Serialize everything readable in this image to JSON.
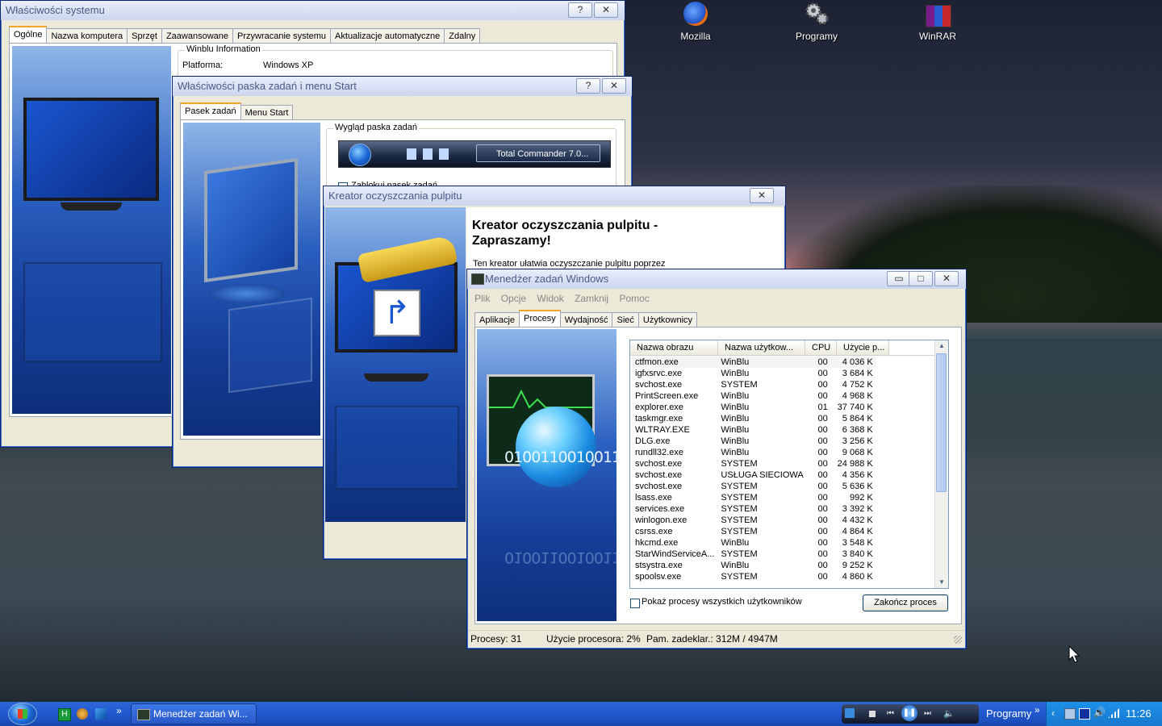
{
  "desktop": {
    "icons": [
      {
        "label": "Mozilla",
        "icon": "firefox-icon"
      },
      {
        "label": "Programy",
        "icon": "gears-icon"
      },
      {
        "label": "WinRAR",
        "icon": "winrar-icon"
      }
    ]
  },
  "sysprops": {
    "title": "Właściwości systemu",
    "help": "?",
    "close": "✕",
    "tabs": [
      "Ogólne",
      "Nazwa komputera",
      "Sprzęt",
      "Zaawansowane",
      "Przywracanie systemu",
      "Aktualizacje automatyczne",
      "Zdalny"
    ],
    "group_title": "Winblu Information",
    "platform_label": "Platforma:",
    "platform_value": "Windows XP"
  },
  "taskbarprops": {
    "title": "Właściwości paska zadań i menu Start",
    "help": "?",
    "close": "✕",
    "tabs": [
      "Pasek zadań",
      "Menu Start"
    ],
    "group_title": "Wygląd paska zadań",
    "preview_task": "Total Commander 7.0...",
    "lock_label": "Zablokuj pasek zadań"
  },
  "cleanup": {
    "title": "Kreator oczyszczania pulpitu",
    "close": "✕",
    "heading": "Kreator oczyszczania pulpitu - Zapraszamy!",
    "body": "Ten kreator ułatwia oczyszczanie pulpitu poprzez"
  },
  "taskmgr": {
    "title": "Menedżer zadań Windows",
    "min": "▭",
    "max": "□",
    "close": "✕",
    "menu": [
      "Plik",
      "Opcje",
      "Widok",
      "Zamknij",
      "Pomoc"
    ],
    "tabs": [
      "Aplikacje",
      "Procesy",
      "Wydajność",
      "Sieć",
      "Użytkownicy"
    ],
    "art_text": "0100110010011",
    "art_text_reflect": "0100110010011",
    "columns": [
      "Nazwa obrazu",
      "Nazwa użytkow...",
      "CPU",
      "Użycie p..."
    ],
    "rows": [
      [
        "ctfmon.exe",
        "WinBlu",
        "00",
        "4 036 K"
      ],
      [
        "igfxsrvc.exe",
        "WinBlu",
        "00",
        "3 684 K"
      ],
      [
        "svchost.exe",
        "SYSTEM",
        "00",
        "4 752 K"
      ],
      [
        "PrintScreen.exe",
        "WinBlu",
        "00",
        "4 968 K"
      ],
      [
        "explorer.exe",
        "WinBlu",
        "01",
        "37 740 K"
      ],
      [
        "taskmgr.exe",
        "WinBlu",
        "00",
        "5 864 K"
      ],
      [
        "WLTRAY.EXE",
        "WinBlu",
        "00",
        "6 368 K"
      ],
      [
        "DLG.exe",
        "WinBlu",
        "00",
        "3 256 K"
      ],
      [
        "rundll32.exe",
        "WinBlu",
        "00",
        "9 068 K"
      ],
      [
        "svchost.exe",
        "SYSTEM",
        "00",
        "24 988 K"
      ],
      [
        "svchost.exe",
        "USŁUGA SIECIOWA",
        "00",
        "4 356 K"
      ],
      [
        "svchost.exe",
        "SYSTEM",
        "00",
        "5 636 K"
      ],
      [
        "lsass.exe",
        "SYSTEM",
        "00",
        "992 K"
      ],
      [
        "services.exe",
        "SYSTEM",
        "00",
        "3 392 K"
      ],
      [
        "winlogon.exe",
        "SYSTEM",
        "00",
        "4 432 K"
      ],
      [
        "csrss.exe",
        "SYSTEM",
        "00",
        "4 864 K"
      ],
      [
        "hkcmd.exe",
        "WinBlu",
        "00",
        "3 548 K"
      ],
      [
        "StarWindServiceA...",
        "SYSTEM",
        "00",
        "3 840 K"
      ],
      [
        "stsystra.exe",
        "WinBlu",
        "00",
        "9 252 K"
      ],
      [
        "spoolsv.exe",
        "SYSTEM",
        "00",
        "4 860 K"
      ]
    ],
    "show_all_label": "Pokaż procesy wszystkich użytkowników",
    "end_process": "Zakończ proces",
    "status": {
      "processes": "Procesy: 31",
      "cpu": "Użycie procesora: 2%",
      "mem": "Pam. zadeklar.: 312M / 4947M"
    }
  },
  "taskbar": {
    "task_label": "Menedżer zadań Wi...",
    "chevron": "»",
    "tray_label": "Programy",
    "tray_chevron": "»",
    "clock": "11:26"
  }
}
